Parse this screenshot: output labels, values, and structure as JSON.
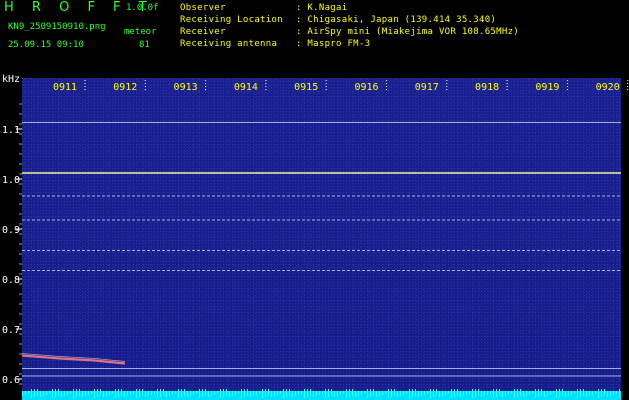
{
  "header": {
    "brand": "H R O F F T",
    "version": "1.0.0f",
    "filename": "KN9_2509150910.png",
    "meteor_label": "meteor",
    "datetime": "25.09.15 09:10",
    "meteor_count": "81"
  },
  "station": {
    "rows": [
      {
        "label": "Observer",
        "value": ": K.Nagai"
      },
      {
        "label": "Receiving Location",
        "value": ": Chigasaki, Japan (139.414 35.340)"
      },
      {
        "label": "Receiver",
        "value": ": AirSpy mini (Miakejima VOR 108.65MHz)"
      },
      {
        "label": "Receiving antenna",
        "value": ": Maspro FM-3"
      }
    ]
  },
  "spectrogram": {
    "freq_unit": "kHz",
    "freq_ticks": [
      "1.1",
      "1.0",
      "0.9",
      "0.8",
      "0.7",
      "0.6"
    ],
    "freq_values": [
      1.1,
      1.0,
      0.9,
      0.8,
      0.7,
      0.6
    ],
    "time_ticks": [
      "0911",
      "0912",
      "0913",
      "0914",
      "0915",
      "0916",
      "0917",
      "0918",
      "0919",
      "0920"
    ],
    "carrier_lines_khz": [
      1.113,
      1.012,
      0.966,
      0.918,
      0.857,
      0.817,
      0.621,
      0.606
    ],
    "meteor_echo_khz": 0.643,
    "colors": {
      "background": "#1a1f8f",
      "carrier": "#c0e8ff",
      "strong_carrier": "#ffff90",
      "tick_text": "#ffff00",
      "axis_text": "#ffffff",
      "meteor": "#ff8080",
      "bottom_band": "#00e0ff"
    }
  }
}
